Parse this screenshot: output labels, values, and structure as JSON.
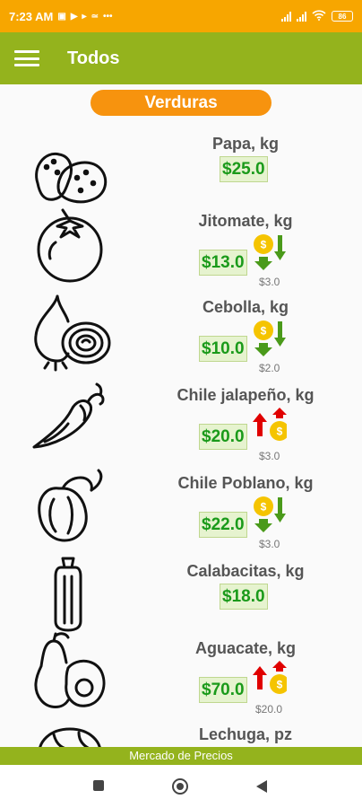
{
  "status_bar": {
    "time": "7:23 AM",
    "battery": "86"
  },
  "app_bar": {
    "title": "Todos"
  },
  "category": {
    "label": "Verduras"
  },
  "products": [
    {
      "name": "Papa, kg",
      "price": "$25.0",
      "change": "",
      "trend": "none",
      "icon": "potato-icon"
    },
    {
      "name": "Jitomate, kg",
      "price": "$13.0",
      "change": "$3.0",
      "trend": "down",
      "icon": "tomato-icon"
    },
    {
      "name": "Cebolla, kg",
      "price": "$10.0",
      "change": "$2.0",
      "trend": "down",
      "icon": "onion-icon"
    },
    {
      "name": "Chile jalapeño, kg",
      "price": "$20.0",
      "change": "$3.0",
      "trend": "up",
      "icon": "chili-pepper-icon"
    },
    {
      "name": "Chile Poblano, kg",
      "price": "$22.0",
      "change": "$3.0",
      "trend": "down",
      "icon": "bell-pepper-icon"
    },
    {
      "name": "Calabacitas, kg",
      "price": "$18.0",
      "change": "",
      "trend": "none",
      "icon": "zucchini-icon"
    },
    {
      "name": "Aguacate, kg",
      "price": "$70.0",
      "change": "$20.0",
      "trend": "up",
      "icon": "avocado-icon"
    },
    {
      "name": "Lechuga, pz",
      "price": "",
      "change": "",
      "trend": "none",
      "icon": "lettuce-icon"
    }
  ],
  "footer": {
    "text": "Mercado de Precios"
  },
  "colors": {
    "status_bar": "#f7a600",
    "app_bar": "#94b31d",
    "pill": "#f7930e",
    "price": "#1a9a1a",
    "coin": "#f5c400",
    "up": "#e00000",
    "down": "#4a9a1a"
  }
}
